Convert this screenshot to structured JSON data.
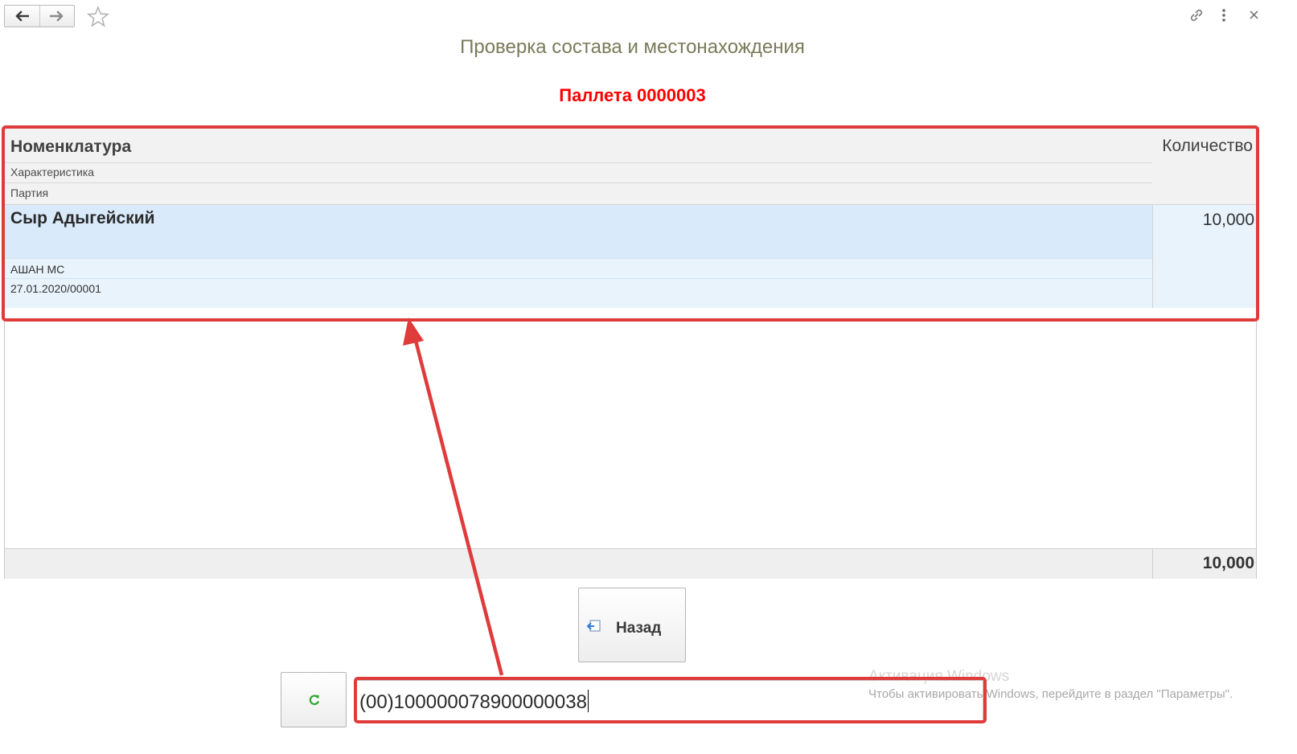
{
  "form": {
    "title": "Проверка состава и местонахождения",
    "pallet_title": "Паллета 0000003"
  },
  "table": {
    "columns": {
      "nomenclature": "Номенклатура",
      "characteristic": "Характеристика",
      "batch": "Партия",
      "quantity": "Количество"
    },
    "rows": [
      {
        "nomenclature": "Сыр Адыгейский",
        "characteristic": "АШАН МС",
        "batch": "27.01.2020/00001",
        "quantity": "10,000"
      }
    ],
    "total_quantity": "10,000"
  },
  "buttons": {
    "back_label": "Назад"
  },
  "barcode": {
    "value": "(00)100000078900000038"
  },
  "watermark": {
    "title": "Активация Windows",
    "text": "Чтобы активировать Windows, перейдите в раздел \"Параметры\"."
  },
  "icons": {
    "nav_back": "arrow-left-icon",
    "nav_forward": "arrow-right-icon",
    "favorite": "star-icon",
    "link": "link-icon",
    "more": "more-vertical-icon",
    "close": "close-icon",
    "back_button": "exit-icon",
    "refresh": "refresh-icon"
  },
  "colors": {
    "pallet_title": "#ff0000",
    "title": "#7a7a5a",
    "selected_row": "#d9ebfb",
    "highlight": "#e03b3b",
    "refresh_icon": "#2fa52f"
  }
}
